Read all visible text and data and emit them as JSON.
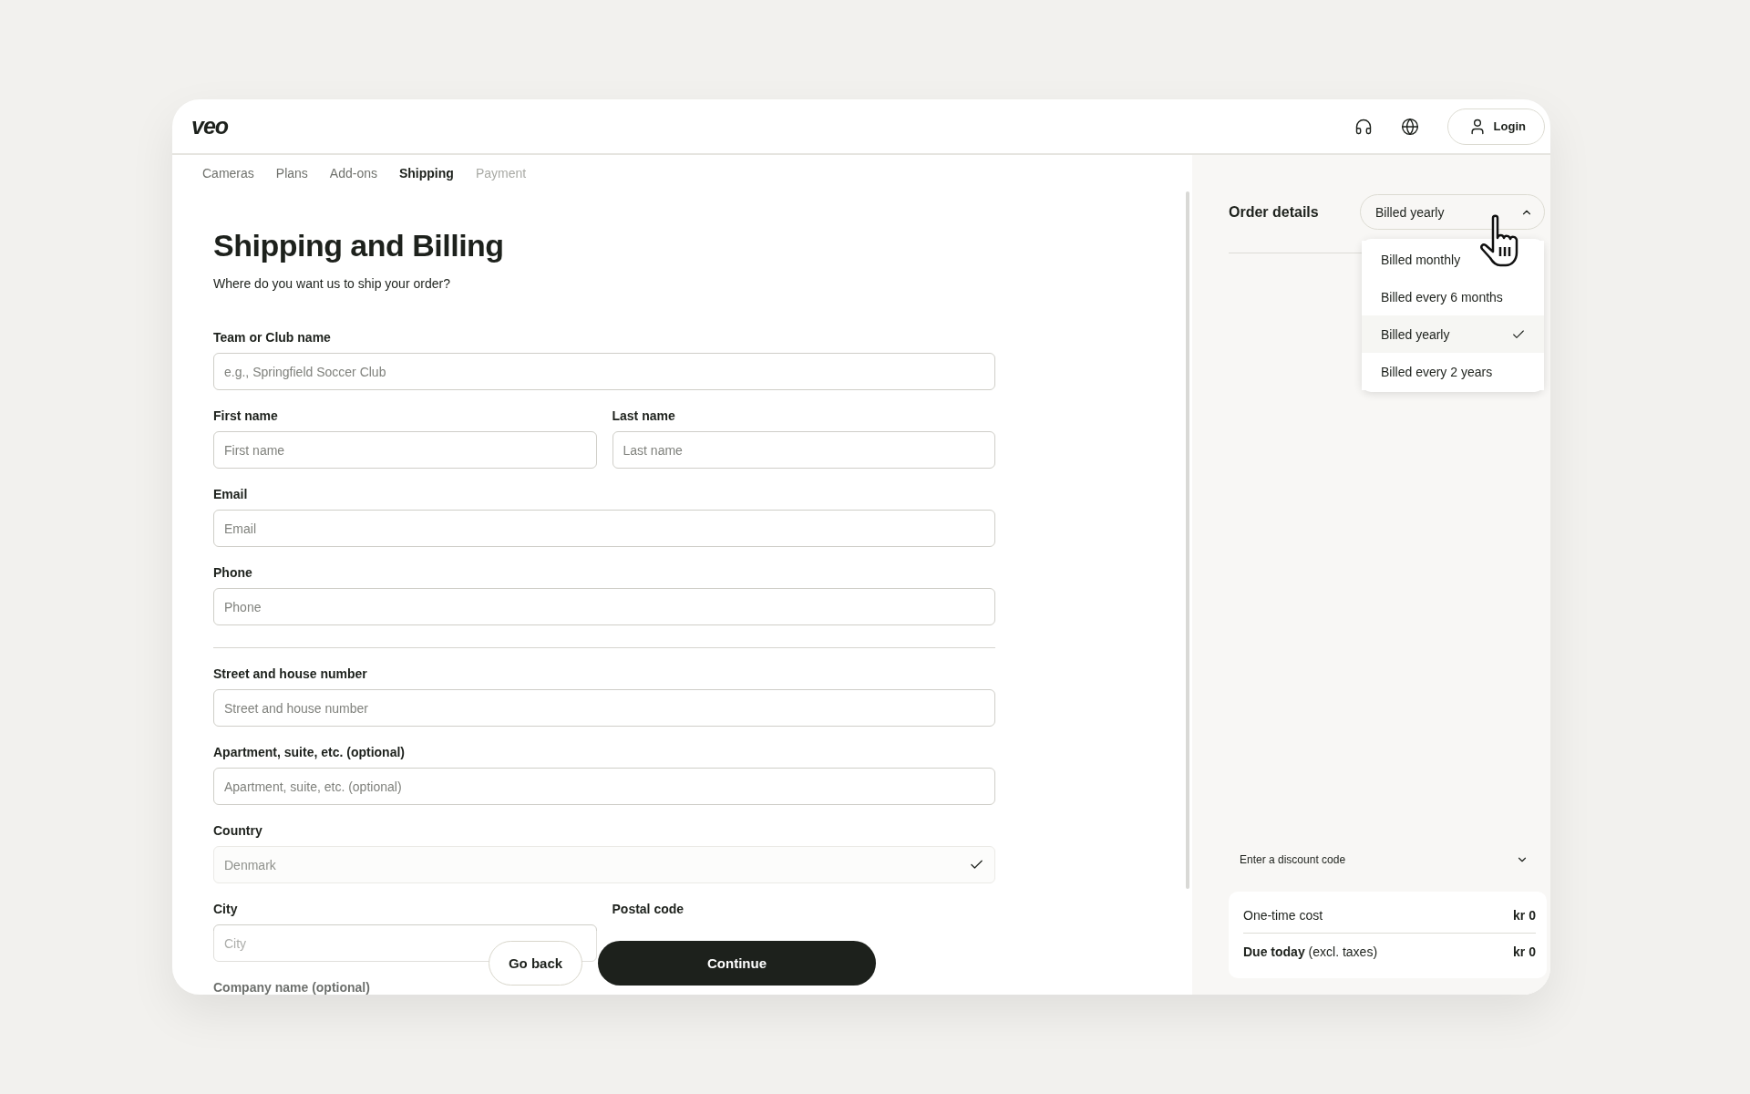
{
  "header": {
    "logo": "veo",
    "login": "Login"
  },
  "steps": [
    {
      "label": "Cameras",
      "selected": false,
      "disabled": false
    },
    {
      "label": "Plans",
      "selected": false,
      "disabled": false
    },
    {
      "label": "Add-ons",
      "selected": false,
      "disabled": false
    },
    {
      "label": "Shipping",
      "selected": true,
      "disabled": false
    },
    {
      "label": "Payment",
      "selected": false,
      "disabled": true
    }
  ],
  "form": {
    "title": "Shipping and Billing",
    "subtitle": "Where do you want us to ship your order?",
    "rows": [
      {
        "kind": "fields",
        "fields": [
          {
            "label": "Team or Club name",
            "placeholder": "e.g., Springfield Soccer Club",
            "disabled": false,
            "valid": false
          }
        ]
      },
      {
        "kind": "fields",
        "fields": [
          {
            "label": "First name",
            "placeholder": "First name",
            "disabled": false,
            "valid": false
          },
          {
            "label": "Last name",
            "placeholder": "Last name",
            "disabled": false,
            "valid": false
          }
        ]
      },
      {
        "kind": "fields",
        "fields": [
          {
            "label": "Email",
            "placeholder": "Email",
            "disabled": false,
            "valid": false
          }
        ]
      },
      {
        "kind": "fields",
        "fields": [
          {
            "label": "Phone",
            "placeholder": "Phone",
            "disabled": false,
            "valid": false
          }
        ]
      },
      {
        "kind": "divider"
      },
      {
        "kind": "fields",
        "fields": [
          {
            "label": "Street and house number",
            "placeholder": "Street and house number",
            "disabled": false,
            "valid": false
          }
        ]
      },
      {
        "kind": "fields",
        "fields": [
          {
            "label": "Apartment, suite, etc. (optional)",
            "placeholder": "Apartment, suite, etc. (optional)",
            "disabled": false,
            "valid": false
          }
        ]
      },
      {
        "kind": "fields",
        "fields": [
          {
            "label": "Country",
            "value": "Denmark",
            "disabled": true,
            "valid": true
          }
        ]
      },
      {
        "kind": "fields",
        "fields": [
          {
            "label": "City",
            "placeholder": "City",
            "disabled": false,
            "valid": false
          },
          {
            "label": "Postal code"
          }
        ]
      },
      {
        "kind": "fields",
        "fields": [
          {
            "label": "Company name (optional)"
          }
        ]
      }
    ]
  },
  "buttons": [
    {
      "label": "Go back",
      "kind": "secondary"
    },
    {
      "label": "Continue",
      "kind": "primary"
    }
  ],
  "order": {
    "title": "Order details",
    "billing": {
      "value": "Billed yearly",
      "expanded": true,
      "options": [
        {
          "label": "Billed monthly",
          "selected": false
        },
        {
          "label": "Billed every 6 months",
          "selected": false
        },
        {
          "label": "Billed yearly",
          "selected": true
        },
        {
          "label": "Billed every 2 years",
          "selected": false
        }
      ]
    },
    "discount": {
      "label": "Enter a discount code",
      "expanded": false
    },
    "summary": [
      {
        "label": "One-time cost",
        "amount": "kr 0"
      },
      {
        "label": "**Due today** (excl. taxes)",
        "amount": "kr 0"
      }
    ]
  }
}
